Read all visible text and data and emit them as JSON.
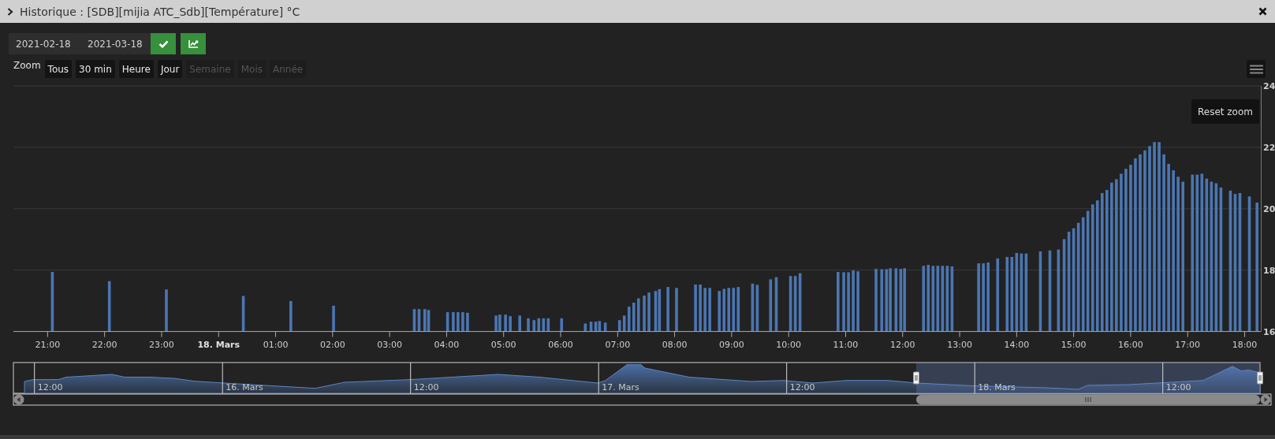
{
  "window": {
    "title": "Historique : [SDB][mijia ATC_Sdb][Température] °C"
  },
  "date_range": {
    "start": "2021-02-18",
    "end": "2021-03-18"
  },
  "zoom": {
    "label": "Zoom",
    "buttons": [
      {
        "label": "Tous",
        "disabled": false
      },
      {
        "label": "30 min",
        "disabled": false
      },
      {
        "label": "Heure",
        "disabled": false
      },
      {
        "label": "Jour",
        "disabled": false
      },
      {
        "label": "Semaine",
        "disabled": true
      },
      {
        "label": "Mois",
        "disabled": true
      },
      {
        "label": "Année",
        "disabled": true
      }
    ]
  },
  "reset_zoom": "Reset zoom",
  "chart": {
    "chart_data": {
      "type": "bar",
      "grid": true,
      "xlim": [
        "2021-03-17T20:24",
        "2021-03-18T18:17"
      ],
      "ylim": [
        16,
        24
      ],
      "yticks": [
        16,
        18,
        20,
        22,
        24
      ],
      "xticks": [
        {
          "value": "2021-03-17T21:00",
          "label": "21:00"
        },
        {
          "value": "2021-03-17T22:00",
          "label": "22:00"
        },
        {
          "value": "2021-03-17T23:00",
          "label": "23:00"
        },
        {
          "value": "2021-03-18T00:00",
          "label": "18. Mars"
        },
        {
          "value": "2021-03-18T01:00",
          "label": "01:00"
        },
        {
          "value": "2021-03-18T02:00",
          "label": "02:00"
        },
        {
          "value": "2021-03-18T03:00",
          "label": "03:00"
        },
        {
          "value": "2021-03-18T04:00",
          "label": "04:00"
        },
        {
          "value": "2021-03-18T05:00",
          "label": "05:00"
        },
        {
          "value": "2021-03-18T06:00",
          "label": "06:00"
        },
        {
          "value": "2021-03-18T07:00",
          "label": "07:00"
        },
        {
          "value": "2021-03-18T08:00",
          "label": "08:00"
        },
        {
          "value": "2021-03-18T09:00",
          "label": "09:00"
        },
        {
          "value": "2021-03-18T10:00",
          "label": "10:00"
        },
        {
          "value": "2021-03-18T11:00",
          "label": "11:00"
        },
        {
          "value": "2021-03-18T12:00",
          "label": "12:00"
        },
        {
          "value": "2021-03-18T13:00",
          "label": "13:00"
        },
        {
          "value": "2021-03-18T14:00",
          "label": "14:00"
        },
        {
          "value": "2021-03-18T15:00",
          "label": "15:00"
        },
        {
          "value": "2021-03-18T16:00",
          "label": "16:00"
        },
        {
          "value": "2021-03-18T17:00",
          "label": "17:00"
        },
        {
          "value": "2021-03-18T18:00",
          "label": "18:00"
        }
      ],
      "x": [
        "2021-03-17T21:05",
        "2021-03-17T22:05",
        "2021-03-17T23:05",
        "2021-03-18T00:26",
        "2021-03-18T01:16",
        "2021-03-18T02:01",
        "2021-03-18T03:26",
        "2021-03-18T03:31",
        "2021-03-18T03:37",
        "2021-03-18T03:41",
        "2021-03-18T04:01",
        "2021-03-18T04:07",
        "2021-03-18T04:12",
        "2021-03-18T04:17",
        "2021-03-18T04:22",
        "2021-03-18T04:52",
        "2021-03-18T04:56",
        "2021-03-18T05:02",
        "2021-03-18T05:07",
        "2021-03-18T05:17",
        "2021-03-18T05:26",
        "2021-03-18T05:32",
        "2021-03-18T05:37",
        "2021-03-18T05:42",
        "2021-03-18T05:47",
        "2021-03-18T06:01",
        "2021-03-18T06:26",
        "2021-03-18T06:32",
        "2021-03-18T06:37",
        "2021-03-18T06:41",
        "2021-03-18T06:47",
        "2021-03-18T07:02",
        "2021-03-18T07:07",
        "2021-03-18T07:12",
        "2021-03-18T07:17",
        "2021-03-18T07:22",
        "2021-03-18T07:28",
        "2021-03-18T07:33",
        "2021-03-18T07:40",
        "2021-03-18T07:44",
        "2021-03-18T07:53",
        "2021-03-18T08:02",
        "2021-03-18T08:22",
        "2021-03-18T08:27",
        "2021-03-18T08:32",
        "2021-03-18T08:37",
        "2021-03-18T08:47",
        "2021-03-18T08:52",
        "2021-03-18T08:57",
        "2021-03-18T09:02",
        "2021-03-18T09:07",
        "2021-03-18T09:22",
        "2021-03-18T09:27",
        "2021-03-18T09:41",
        "2021-03-18T09:47",
        "2021-03-18T10:02",
        "2021-03-18T10:07",
        "2021-03-18T10:12",
        "2021-03-18T10:52",
        "2021-03-18T10:58",
        "2021-03-18T11:03",
        "2021-03-18T11:08",
        "2021-03-18T11:13",
        "2021-03-18T11:32",
        "2021-03-18T11:38",
        "2021-03-18T11:43",
        "2021-03-18T11:47",
        "2021-03-18T11:53",
        "2021-03-18T11:58",
        "2021-03-18T12:02",
        "2021-03-18T12:22",
        "2021-03-18T12:27",
        "2021-03-18T12:32",
        "2021-03-18T12:37",
        "2021-03-18T12:42",
        "2021-03-18T12:47",
        "2021-03-18T12:52",
        "2021-03-18T13:20",
        "2021-03-18T13:25",
        "2021-03-18T13:30",
        "2021-03-18T13:40",
        "2021-03-18T13:50",
        "2021-03-18T13:55",
        "2021-03-18T14:00",
        "2021-03-18T14:05",
        "2021-03-18T14:10",
        "2021-03-18T14:25",
        "2021-03-18T14:35",
        "2021-03-18T14:44",
        "2021-03-18T14:50",
        "2021-03-18T14:55",
        "2021-03-18T15:00",
        "2021-03-18T15:05",
        "2021-03-18T15:10",
        "2021-03-18T15:15",
        "2021-03-18T15:20",
        "2021-03-18T15:25",
        "2021-03-18T15:30",
        "2021-03-18T15:35",
        "2021-03-18T15:40",
        "2021-03-18T15:45",
        "2021-03-18T15:50",
        "2021-03-18T15:55",
        "2021-03-18T16:00",
        "2021-03-18T16:05",
        "2021-03-18T16:10",
        "2021-03-18T16:15",
        "2021-03-18T16:20",
        "2021-03-18T16:25",
        "2021-03-18T16:30",
        "2021-03-18T16:35",
        "2021-03-18T16:40",
        "2021-03-18T16:45",
        "2021-03-18T16:50",
        "2021-03-18T16:55",
        "2021-03-18T17:05",
        "2021-03-18T17:10",
        "2021-03-18T17:15",
        "2021-03-18T17:20",
        "2021-03-18T17:25",
        "2021-03-18T17:30",
        "2021-03-18T17:35",
        "2021-03-18T17:45",
        "2021-03-18T17:50",
        "2021-03-18T17:55",
        "2021-03-18T18:05",
        "2021-03-18T18:13"
      ],
      "values": [
        17.94,
        17.64,
        17.37,
        17.16,
        16.99,
        16.84,
        16.73,
        16.73,
        16.73,
        16.7,
        16.63,
        16.63,
        16.63,
        16.63,
        16.61,
        16.52,
        16.55,
        16.55,
        16.5,
        16.52,
        16.43,
        16.37,
        16.43,
        16.43,
        16.43,
        16.43,
        16.26,
        16.32,
        16.32,
        16.34,
        16.29,
        16.37,
        16.52,
        16.81,
        16.94,
        17.08,
        17.17,
        17.27,
        17.32,
        17.38,
        17.45,
        17.42,
        17.53,
        17.53,
        17.42,
        17.42,
        17.32,
        17.39,
        17.42,
        17.42,
        17.45,
        17.56,
        17.52,
        17.7,
        17.77,
        17.81,
        17.81,
        17.9,
        17.94,
        17.93,
        17.93,
        17.99,
        17.96,
        18.04,
        18.03,
        18.03,
        18.06,
        18.06,
        18.04,
        18.06,
        18.14,
        18.17,
        18.14,
        18.14,
        18.14,
        18.14,
        18.12,
        18.22,
        18.22,
        18.25,
        18.38,
        18.43,
        18.43,
        18.56,
        18.54,
        18.54,
        18.61,
        18.64,
        18.67,
        19.01,
        19.25,
        19.36,
        19.54,
        19.72,
        19.93,
        20.14,
        20.27,
        20.51,
        20.61,
        20.85,
        20.96,
        21.14,
        21.3,
        21.43,
        21.64,
        21.77,
        21.9,
        22.04,
        22.17,
        22.17,
        21.77,
        21.46,
        21.25,
        21.04,
        20.88,
        21.11,
        21.11,
        21.14,
        20.98,
        20.88,
        20.83,
        20.69,
        20.59,
        20.48,
        20.51,
        20.4,
        20.2
      ]
    }
  },
  "navigator": {
    "labels": [
      "12:00",
      "16. Mars",
      "12:00",
      "17. Mars",
      "12:00",
      "18. Mars",
      "12:00"
    ]
  }
}
